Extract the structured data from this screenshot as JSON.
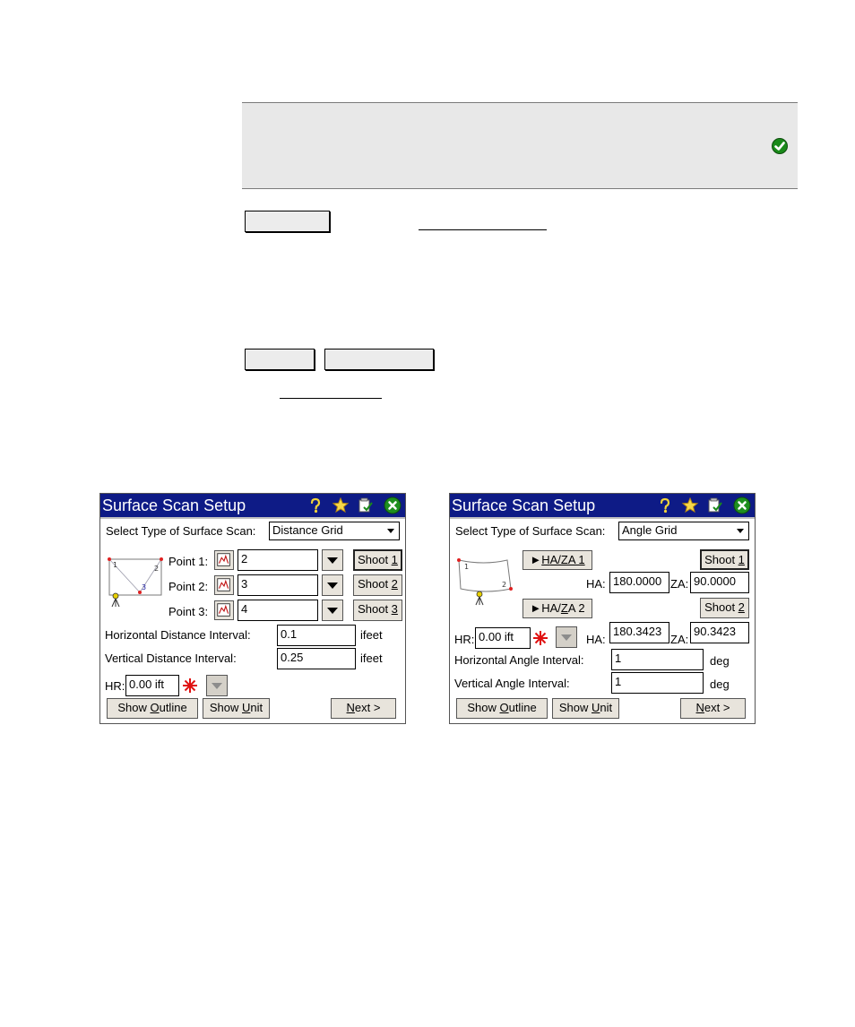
{
  "doc": {
    "note_icon": "check-circle-icon",
    "accent_color": "#1a8a1a"
  },
  "left_screen": {
    "title": "Surface Scan Setup",
    "icons": [
      "help-icon",
      "favorites-icon",
      "options-icon",
      "close-icon"
    ],
    "scan_type_label": "Select Type of Surface Scan:",
    "scan_type_value": "Distance Grid",
    "points": [
      {
        "label": "Point 1:",
        "value": "2",
        "shoot_prefix": "Shoot ",
        "shoot_key": "1"
      },
      {
        "label": "Point 2:",
        "value": "3",
        "shoot_prefix": "Shoot ",
        "shoot_key": "2"
      },
      {
        "label": "Point 3:",
        "value": "4",
        "shoot_prefix": "Shoot ",
        "shoot_key": "3"
      }
    ],
    "h_interval_label": "Horizontal Distance Interval:",
    "h_interval_value": "0.1",
    "h_interval_unit": "ifeet",
    "v_interval_label": "Vertical Distance Interval:",
    "v_interval_value": "0.25",
    "v_interval_unit": "ifeet",
    "hr_label": "HR:",
    "hr_value": "0.00 ift",
    "show_outline": {
      "prefix": "Show ",
      "key": "O",
      "suffix": "utline"
    },
    "show_unit": {
      "prefix": "Show ",
      "key": "U",
      "suffix": "nit"
    },
    "next": {
      "key": "N",
      "suffix": "ext >"
    },
    "diagram_labels": [
      "1",
      "2",
      "3"
    ]
  },
  "right_screen": {
    "title": "Surface Scan Setup",
    "icons": [
      "help-icon",
      "favorites-icon",
      "options-icon",
      "close-icon"
    ],
    "scan_type_label": "Select Type of Surface Scan:",
    "scan_type_value": "Angle Grid",
    "haza1": {
      "key": "H",
      "mid": "A/ZA 1"
    },
    "haza2": {
      "prefix": "HA/",
      "key": "Z",
      "suffix": "A 2"
    },
    "shoot1": {
      "prefix": "Shoot ",
      "key": "1"
    },
    "shoot2": {
      "prefix": "Shoot ",
      "key": "2"
    },
    "ha_label": "HA:",
    "za_label": "ZA:",
    "ha1_value": "180.0000",
    "za1_value": "90.0000",
    "ha2_value": "180.3423",
    "za2_value": "90.3423",
    "hr_label": "HR:",
    "hr_value": "0.00 ift",
    "h_interval_label": "Horizontal Angle Interval:",
    "h_interval_value": "1",
    "h_interval_unit": "deg",
    "v_interval_label": "Vertical Angle Interval:",
    "v_interval_value": "1",
    "v_interval_unit": "deg",
    "show_outline": {
      "prefix": "Show ",
      "key": "O",
      "suffix": "utline"
    },
    "show_unit": {
      "prefix": "Show ",
      "key": "U",
      "suffix": "nit"
    },
    "next": {
      "key": "N",
      "suffix": "ext >"
    },
    "diagram_labels": [
      "1",
      "2"
    ]
  }
}
